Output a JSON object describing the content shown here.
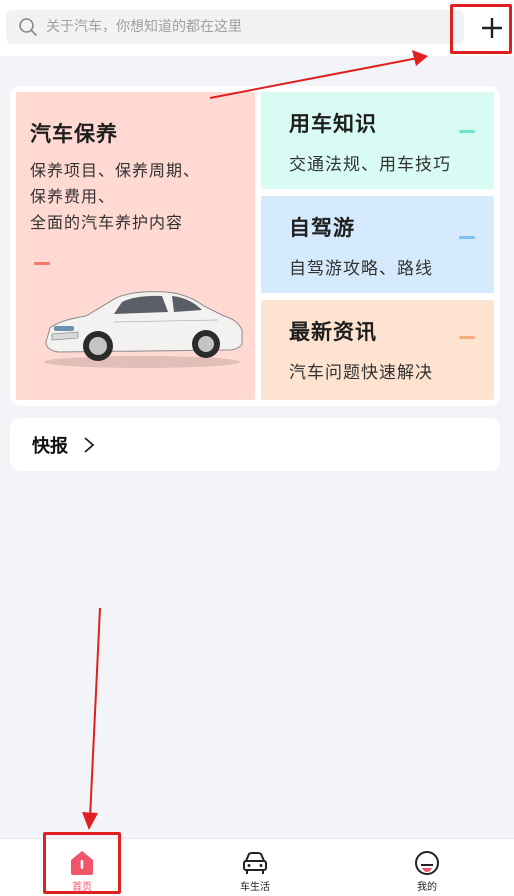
{
  "search": {
    "placeholder": "关于汽车，你想知道的都在这里"
  },
  "cards": {
    "main": {
      "title": "汽车保养",
      "desc_lines": [
        "保养项目、保养周期、",
        "保养费用、",
        "全面的汽车养护内容"
      ]
    },
    "knowledge": {
      "title": "用车知识",
      "subtitle": "交通法规、用车技巧"
    },
    "selfdrive": {
      "title": "自驾游",
      "subtitle": "自驾游攻略、路线"
    },
    "news": {
      "title": "最新资讯",
      "subtitle": "汽车问题快速解决"
    }
  },
  "quick_news": {
    "label": "快报"
  },
  "bottom_nav": {
    "items": [
      {
        "label": "首页",
        "icon": "home-icon",
        "active": true
      },
      {
        "label": "车生活",
        "icon": "car-icon",
        "active": false
      },
      {
        "label": "我的",
        "icon": "profile-icon",
        "active": false
      }
    ]
  },
  "colors": {
    "accent": "#f0556a",
    "annotation": "#e02020",
    "main_tile": "#ffd9d2",
    "knowledge_tile": "#d8fbf3",
    "selfdrive_tile": "#d5eafc",
    "news_tile": "#ffe3d1"
  }
}
